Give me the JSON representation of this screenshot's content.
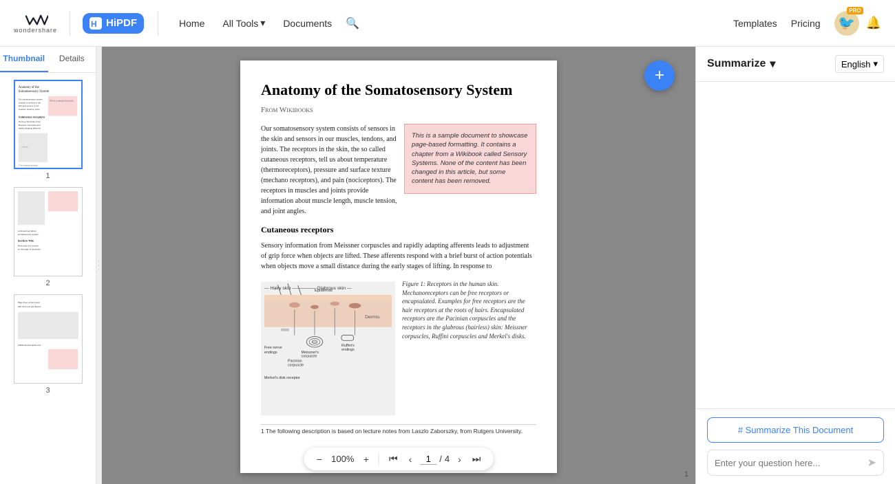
{
  "header": {
    "brand_label": "wondershare",
    "hipdf_label": "HiPDF",
    "nav_home": "Home",
    "nav_alltools": "All Tools",
    "nav_documents": "Documents",
    "nav_templates": "Templates",
    "nav_pricing": "Pricing"
  },
  "sidebar": {
    "tab_thumbnail": "Thumbnail",
    "tab_details": "Details",
    "thumbnails": [
      {
        "number": "1",
        "selected": true
      },
      {
        "number": "2",
        "selected": false
      },
      {
        "number": "3",
        "selected": false
      }
    ]
  },
  "document": {
    "title": "Anatomy of the Somatosensory System",
    "subtitle": "From Wikibooks",
    "body1": "Our somatosensory system consists of sensors in the skin and sensors in our muscles, tendons, and joints. The receptors in the skin, the so called cutaneous receptors, tell us about temperature (thermoreceptors), pressure and surface texture (mechano receptors), and pain (nociceptors). The receptors in muscles and joints provide information about muscle length, muscle tension, and joint angles.",
    "note_box": "This is a sample document to showcase page-based formatting. It contains a chapter from a Wikibook called Sensory Systems. None of the content has been changed in this article, but some content has been removed.",
    "section_cutaneous": "Cutaneous receptors",
    "body2": "Sensory information from Meissner corpuscles and rapidly adapting afferents leads to adjustment of grip force when objects are lifted. These afferents respond with a brief burst of action potentials when objects move a small distance during the early stages of lifting. In response to",
    "figure_caption": "Figure 1: Receptors in the human skin. Mechanoreceptors can be free receptors or encapsulated. Examples for free receptors are the hair receptors at the roots of hairs. Encapsulated receptors are the Pacinian corpuscles and the receptors in the glabrous (hairless) skin: Meissner corpuscles, Ruffini corpuscles and Merkel's disks.",
    "footnote": "1 The following description is based on lecture notes from Laszlo Zaborszky, from Rutgers University.",
    "page_current": "1",
    "page_total": "4",
    "zoom": "100%",
    "page_number_label": "1"
  },
  "toolbar": {
    "zoom_out": "−",
    "zoom_in": "+",
    "zoom_level": "100%",
    "first_page": "⏮",
    "prev_page": "‹",
    "next_page": "›",
    "last_page": "⏭",
    "page_divider": "/",
    "fab_icon": "+"
  },
  "right_panel": {
    "title": "Summarize",
    "dropdown_icon": "▾",
    "lang_label": "English",
    "lang_dropdown_icon": "▾",
    "summarize_btn": "# Summarize This Document",
    "question_placeholder": "Enter your question here...",
    "send_icon": "➤"
  }
}
